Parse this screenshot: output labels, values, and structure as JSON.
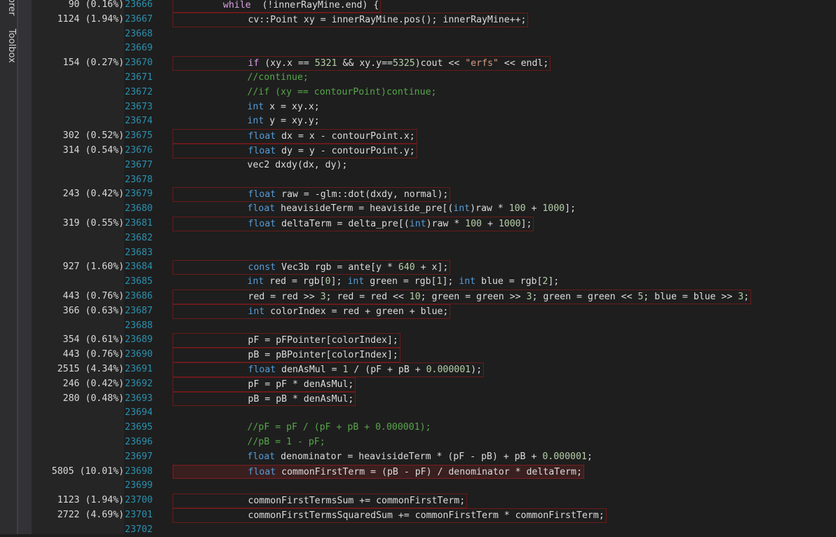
{
  "side_panel": {
    "tabs": [
      "orer",
      "Toolbox"
    ]
  },
  "colors": {
    "background": "#1e1e1e",
    "line_number": "#2b91af",
    "keyword": "#569cd6",
    "control_keyword": "#d8a0df",
    "number": "#b5cea8",
    "string": "#d69d85",
    "comment": "#57a64a",
    "hot_line_border": "#6b1a1a"
  },
  "lines": [
    {
      "num": "23666",
      "hits": "90 (0.16%)",
      "indent": 2,
      "tokens": [
        [
          "kw2",
          "while"
        ],
        [
          "",
          "  (!innerRayMine.end) {"
        ]
      ]
    },
    {
      "num": "23667",
      "hits": "1124 (1.94%)",
      "indent": 3,
      "tokens": [
        [
          "",
          "cv::Point xy = innerRayMine.pos(); innerRayMine++;"
        ]
      ]
    },
    {
      "num": "23668",
      "hits": "",
      "indent": 3,
      "tokens": []
    },
    {
      "num": "23669",
      "hits": "",
      "indent": 3,
      "tokens": []
    },
    {
      "num": "23670",
      "hits": "154 (0.27%)",
      "indent": 3,
      "tokens": [
        [
          "kw2",
          "if"
        ],
        [
          "",
          " (xy.x == "
        ],
        [
          "num",
          "5321"
        ],
        [
          "",
          " && xy.y=="
        ],
        [
          "num",
          "5325"
        ],
        [
          "",
          ")cout << "
        ],
        [
          "str",
          "\"erfs\""
        ],
        [
          "",
          " << endl;"
        ]
      ]
    },
    {
      "num": "23671",
      "hits": "",
      "indent": 3,
      "tokens": [
        [
          "cmt",
          "//continue;"
        ]
      ]
    },
    {
      "num": "23672",
      "hits": "",
      "indent": 3,
      "tokens": [
        [
          "cmt",
          "//if (xy == contourPoint)continue;"
        ]
      ]
    },
    {
      "num": "23673",
      "hits": "",
      "indent": 3,
      "tokens": [
        [
          "kw",
          "int"
        ],
        [
          "",
          " x = xy.x;"
        ]
      ]
    },
    {
      "num": "23674",
      "hits": "",
      "indent": 3,
      "tokens": [
        [
          "kw",
          "int"
        ],
        [
          "",
          " y = xy.y;"
        ]
      ]
    },
    {
      "num": "23675",
      "hits": "302 (0.52%)",
      "indent": 3,
      "tokens": [
        [
          "kw",
          "float"
        ],
        [
          "",
          " dx = x - contourPoint.x;"
        ]
      ]
    },
    {
      "num": "23676",
      "hits": "314 (0.54%)",
      "indent": 3,
      "tokens": [
        [
          "kw",
          "float"
        ],
        [
          "",
          " dy = y - contourPoint.y;"
        ]
      ]
    },
    {
      "num": "23677",
      "hits": "",
      "indent": 3,
      "tokens": [
        [
          "",
          "vec2 dxdy(dx, dy);"
        ]
      ]
    },
    {
      "num": "23678",
      "hits": "",
      "indent": 3,
      "tokens": []
    },
    {
      "num": "23679",
      "hits": "243 (0.42%)",
      "indent": 3,
      "tokens": [
        [
          "kw",
          "float"
        ],
        [
          "",
          " raw = -glm::dot(dxdy, normal);"
        ]
      ]
    },
    {
      "num": "23680",
      "hits": "",
      "indent": 3,
      "tokens": [
        [
          "kw",
          "float"
        ],
        [
          "",
          " heavisideTerm = heaviside_pre[("
        ],
        [
          "kw",
          "int"
        ],
        [
          "",
          ")raw * "
        ],
        [
          "num",
          "100"
        ],
        [
          "",
          " + "
        ],
        [
          "num",
          "1000"
        ],
        [
          "",
          "];"
        ]
      ]
    },
    {
      "num": "23681",
      "hits": "319 (0.55%)",
      "indent": 3,
      "tokens": [
        [
          "kw",
          "float"
        ],
        [
          "",
          " deltaTerm = delta_pre[("
        ],
        [
          "kw",
          "int"
        ],
        [
          "",
          ")raw * "
        ],
        [
          "num",
          "100"
        ],
        [
          "",
          " + "
        ],
        [
          "num",
          "1000"
        ],
        [
          "",
          "];"
        ]
      ]
    },
    {
      "num": "23682",
      "hits": "",
      "indent": 3,
      "tokens": []
    },
    {
      "num": "23683",
      "hits": "",
      "indent": 3,
      "tokens": []
    },
    {
      "num": "23684",
      "hits": "927 (1.60%)",
      "indent": 3,
      "tokens": [
        [
          "kw",
          "const"
        ],
        [
          "",
          " Vec3b rgb = ante[y * "
        ],
        [
          "num",
          "640"
        ],
        [
          "",
          " + x];"
        ]
      ]
    },
    {
      "num": "23685",
      "hits": "",
      "indent": 3,
      "tokens": [
        [
          "kw",
          "int"
        ],
        [
          "",
          " red = rgb["
        ],
        [
          "num",
          "0"
        ],
        [
          "",
          "]; "
        ],
        [
          "kw",
          "int"
        ],
        [
          "",
          " green = rgb["
        ],
        [
          "num",
          "1"
        ],
        [
          "",
          "]; "
        ],
        [
          "kw",
          "int"
        ],
        [
          "",
          " blue = rgb["
        ],
        [
          "num",
          "2"
        ],
        [
          "",
          "];"
        ]
      ]
    },
    {
      "num": "23686",
      "hits": "443 (0.76%)",
      "indent": 3,
      "tokens": [
        [
          "",
          "red = red >> "
        ],
        [
          "num",
          "3"
        ],
        [
          "",
          "; red = red << "
        ],
        [
          "num",
          "10"
        ],
        [
          "",
          "; green = green >> "
        ],
        [
          "num",
          "3"
        ],
        [
          "",
          "; green = green << "
        ],
        [
          "num",
          "5"
        ],
        [
          "",
          "; blue = blue >> "
        ],
        [
          "num",
          "3"
        ],
        [
          "",
          ";"
        ]
      ]
    },
    {
      "num": "23687",
      "hits": "366 (0.63%)",
      "indent": 3,
      "tokens": [
        [
          "kw",
          "int"
        ],
        [
          "",
          " colorIndex = red + green + blue;"
        ]
      ]
    },
    {
      "num": "23688",
      "hits": "",
      "indent": 3,
      "tokens": []
    },
    {
      "num": "23689",
      "hits": "354 (0.61%)",
      "indent": 3,
      "tokens": [
        [
          "",
          "pF = pFPointer[colorIndex];"
        ]
      ]
    },
    {
      "num": "23690",
      "hits": "443 (0.76%)",
      "indent": 3,
      "tokens": [
        [
          "",
          "pB = pBPointer[colorIndex];"
        ]
      ]
    },
    {
      "num": "23691",
      "hits": "2515 (4.34%)",
      "indent": 3,
      "tokens": [
        [
          "kw",
          "float"
        ],
        [
          "",
          " denAsMul = "
        ],
        [
          "num",
          "1"
        ],
        [
          "",
          " / (pF + pB + "
        ],
        [
          "num",
          "0.000001"
        ],
        [
          "",
          ");"
        ]
      ]
    },
    {
      "num": "23692",
      "hits": "246 (0.42%)",
      "indent": 3,
      "tokens": [
        [
          "",
          "pF = pF * denAsMul;"
        ]
      ]
    },
    {
      "num": "23693",
      "hits": "280 (0.48%)",
      "indent": 3,
      "tokens": [
        [
          "",
          "pB = pB * denAsMul;"
        ]
      ]
    },
    {
      "num": "23694",
      "hits": "",
      "indent": 3,
      "tokens": []
    },
    {
      "num": "23695",
      "hits": "",
      "indent": 3,
      "tokens": [
        [
          "cmt",
          "//pF = pF / (pF + pB + 0.000001);"
        ]
      ]
    },
    {
      "num": "23696",
      "hits": "",
      "indent": 3,
      "tokens": [
        [
          "cmt",
          "//pB = 1 - pF;"
        ]
      ]
    },
    {
      "num": "23697",
      "hits": "",
      "indent": 3,
      "tokens": [
        [
          "kw",
          "float"
        ],
        [
          "",
          " denominator = heavisideTerm * (pF - pB) + pB + "
        ],
        [
          "num",
          "0.000001"
        ],
        [
          "",
          ";"
        ]
      ]
    },
    {
      "num": "23698",
      "hits": "5805 (10.01%)",
      "indent": 3,
      "strong": true,
      "tokens": [
        [
          "kw",
          "float"
        ],
        [
          "",
          " commonFirstTerm = (pB - pF) / denominator * deltaTerm;"
        ]
      ]
    },
    {
      "num": "23699",
      "hits": "",
      "indent": 3,
      "tokens": []
    },
    {
      "num": "23700",
      "hits": "1123 (1.94%)",
      "indent": 3,
      "tokens": [
        [
          "",
          "commonFirstTermsSum += commonFirstTerm;"
        ]
      ]
    },
    {
      "num": "23701",
      "hits": "2722 (4.69%)",
      "indent": 3,
      "tokens": [
        [
          "",
          "commonFirstTermsSquaredSum += commonFirstTerm * commonFirstTerm;"
        ]
      ]
    },
    {
      "num": "23702",
      "hits": "",
      "indent": 3,
      "tokens": []
    }
  ]
}
